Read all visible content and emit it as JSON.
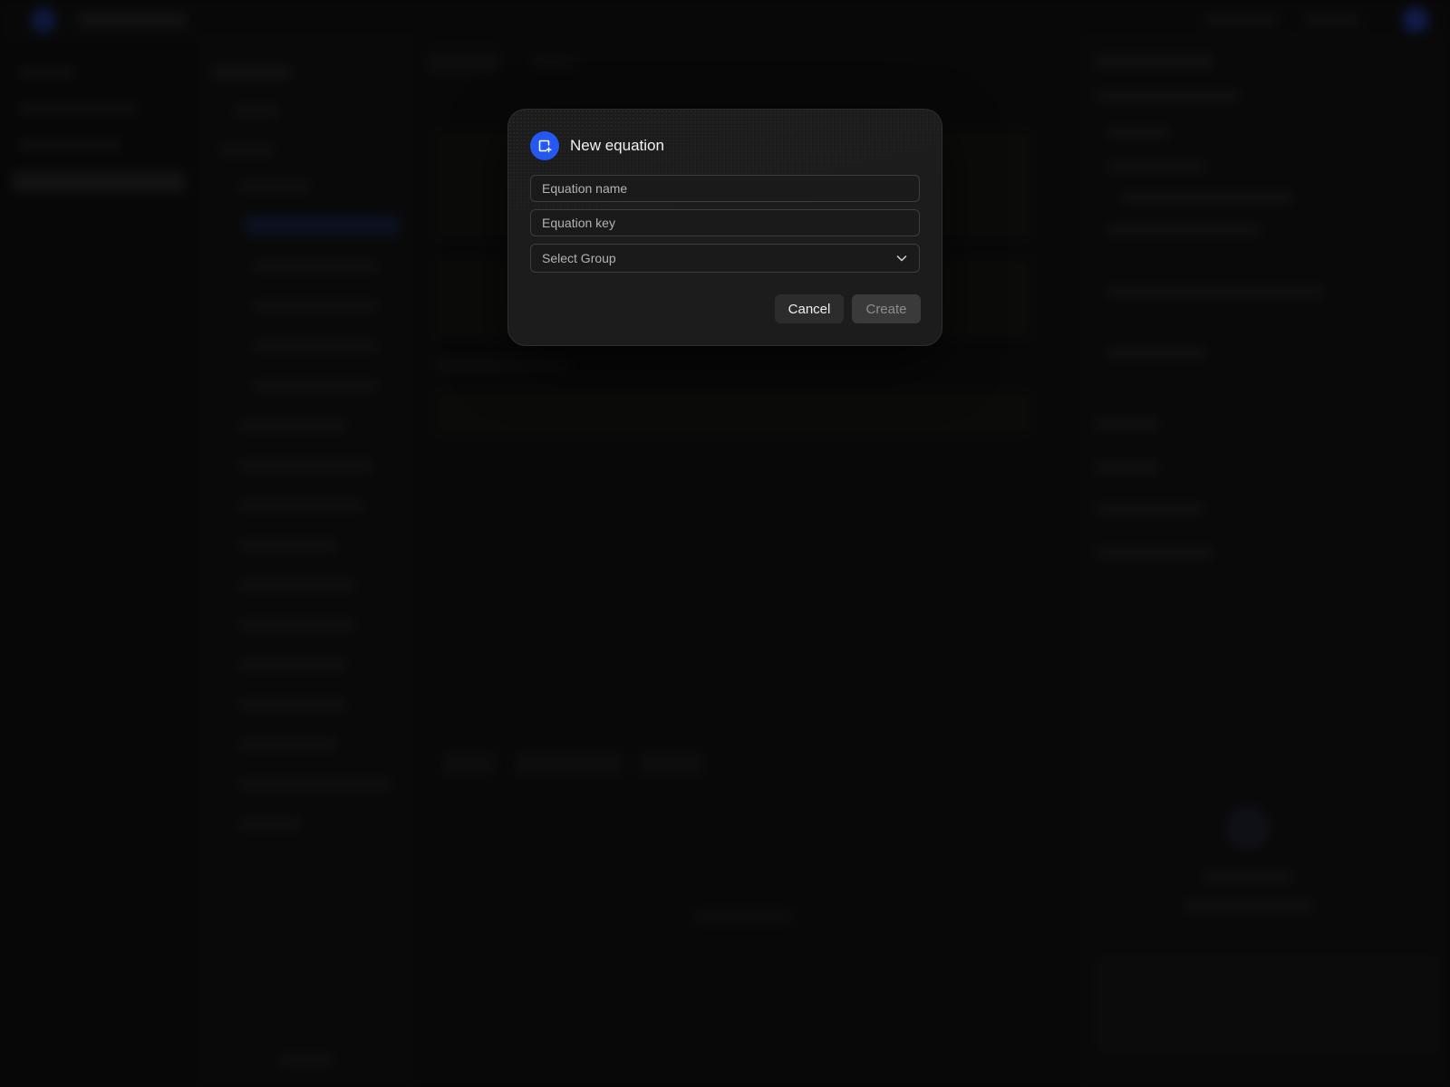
{
  "dialog": {
    "title": "New equation",
    "icon": "new-equation-icon",
    "fields": {
      "name_placeholder": "Equation name",
      "key_placeholder": "Equation key",
      "group_placeholder": "Select Group"
    },
    "buttons": {
      "cancel_label": "Cancel",
      "create_label": "Create"
    }
  },
  "colors": {
    "accent": "#2458f0",
    "modal_bg": "#1c1c1c",
    "page_bg": "#0b0b0b"
  }
}
